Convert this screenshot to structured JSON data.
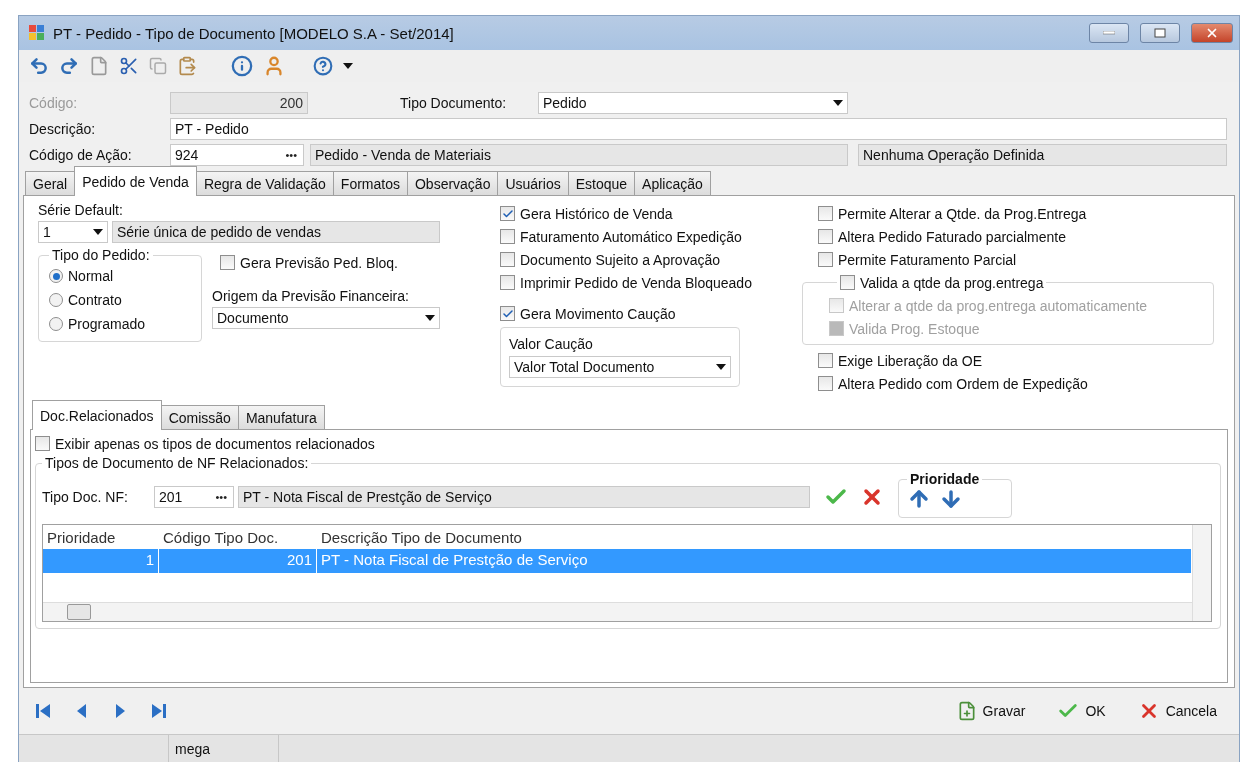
{
  "window": {
    "title": "PT - Pedido -  Tipo de Documento [MODELO S.A - Set/2014]"
  },
  "header": {
    "codigo": {
      "label": "Código:",
      "value": "200",
      "disabled": true
    },
    "tipo_documento": {
      "label": "Tipo Documento:",
      "value": "Pedido"
    },
    "descricao": {
      "label": "Descrição:",
      "value": "PT - Pedido"
    },
    "codigo_acao": {
      "label": "Código de Ação:",
      "value": "924",
      "button": "•••",
      "description": "Pedido - Venda de Materiais",
      "operation": "Nenhuma Operação Definida"
    }
  },
  "tabs": [
    {
      "label": "Geral",
      "selected": false
    },
    {
      "label": "Pedido de Venda",
      "selected": true
    },
    {
      "label": "Regra de Validação",
      "selected": false
    },
    {
      "label": "Formatos",
      "selected": false
    },
    {
      "label": "Observação",
      "selected": false
    },
    {
      "label": "Usuários",
      "selected": false
    },
    {
      "label": "Estoque",
      "selected": false
    },
    {
      "label": "Aplicação",
      "selected": false
    }
  ],
  "pedido_venda": {
    "serie_default": {
      "label": "Série Default:",
      "value": "1",
      "description": "Série única de pedido de vendas"
    },
    "tipo_pedido": {
      "label": "Tipo do Pedido:",
      "options": [
        {
          "label": "Normal",
          "selected": true
        },
        {
          "label": "Contrato",
          "selected": false
        },
        {
          "label": "Programado",
          "selected": false
        }
      ]
    },
    "gera_previsao": {
      "label": "Gera Previsão Ped. Bloq.",
      "checked": false
    },
    "origem_previsao": {
      "label": "Origem da Previsão Financeira:",
      "value": "Documento"
    },
    "middle_checks": [
      {
        "label": "Gera Histórico de Venda",
        "checked": true
      },
      {
        "label": "Faturamento Automático Expedição",
        "checked": false
      },
      {
        "label": "Documento Sujeito a Aprovação",
        "checked": false
      },
      {
        "label": "Imprimir Pedido de Venda Bloqueado",
        "checked": false
      }
    ],
    "gera_movimento": {
      "label": "Gera Movimento Caução",
      "checked": true
    },
    "valor_caucao": {
      "label": "Valor Caução",
      "value": "Valor Total Documento"
    },
    "right_checks": [
      {
        "label": "Permite Alterar a Qtde. da Prog.Entrega",
        "checked": false
      },
      {
        "label": "Altera Pedido Faturado parcialmente",
        "checked": false
      },
      {
        "label": "Permite Faturamento Parcial",
        "checked": false
      }
    ],
    "valida_qtde": {
      "label": "Valida a qtde da prog.entrega",
      "checked": false,
      "children": [
        {
          "label": "Alterar a qtde da prog.entrega automaticamente",
          "checked": false,
          "disabled": true
        },
        {
          "label": "Valida Prog. Estoque",
          "checked": true,
          "disabled": true
        }
      ]
    },
    "bottom_checks": [
      {
        "label": "Exige Liberação da OE",
        "checked": false
      },
      {
        "label": "Altera Pedido com Ordem de Expedição",
        "checked": false
      }
    ]
  },
  "sub_tabs": [
    {
      "label": "Doc.Relacionados",
      "selected": true
    },
    {
      "label": "Comissão",
      "selected": false
    },
    {
      "label": "Manufatura",
      "selected": false
    }
  ],
  "doc_relacionados": {
    "exibir": {
      "label": "Exibir apenas os tipos de documentos relacionados",
      "checked": false
    },
    "group_title": "Tipos de Documento de NF Relacionados:",
    "tipo_doc_nf": {
      "label": "Tipo Doc. NF:",
      "value": "201",
      "button": "•••",
      "description": "PT - Nota Fiscal de Prestção de Serviço"
    },
    "prioridade_title": "Prioridade",
    "table": {
      "columns": [
        "Prioridade",
        "Código Tipo Doc.",
        "Descrição Tipo de Documento"
      ],
      "rows": [
        {
          "cells": [
            "1",
            "201",
            "PT - Nota Fiscal de Prestção de Serviço"
          ],
          "selected": true
        }
      ]
    }
  },
  "footer_buttons": [
    {
      "kind": "save",
      "label": "Gravar"
    },
    {
      "kind": "ok",
      "label": "OK"
    },
    {
      "kind": "cancel",
      "label": "Cancela"
    }
  ],
  "status_bar": [
    "mega"
  ]
}
